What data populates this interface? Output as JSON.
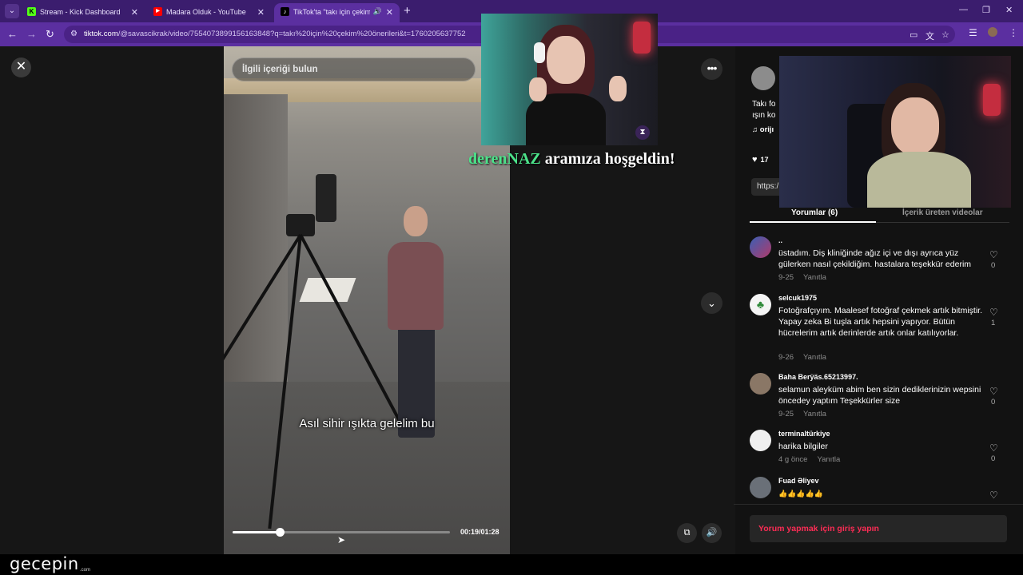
{
  "browser": {
    "tabs": [
      {
        "title": "Stream - Kick Dashboard",
        "favicon": "K"
      },
      {
        "title": "Madara Olduk - YouTube",
        "favicon": "▶"
      },
      {
        "title": "TikTok'ta \"takı için çekim ön",
        "favicon": "♪"
      }
    ],
    "url_host": "tiktok.com",
    "url_path": "/@savascikrak/video/7554073899156163848?q=takı%20için%20çekim%20önerileri&t=1760205637752"
  },
  "video": {
    "search_placeholder": "İlgili içeriği bulun",
    "caption": "Asıl sihir ışıkta gelelim bu",
    "timecode": "00:19/01:28",
    "progress": 0.216
  },
  "panel": {
    "description_line1": "Takı fo",
    "description_line2": "ışın ko",
    "music": "♫  orijı",
    "like_count": "17",
    "link_prefix": "https:/",
    "tabs": [
      "Yorumlar (6)",
      "İçerik üreten videolar"
    ],
    "comments": [
      {
        "user": "..",
        "text": "üstadım. Diş kliniğinde ağız içi ve dışı ayrıca yüz gülerken nasıl çekildiğim. hastalara teşekkür ederim",
        "date": "9-25",
        "reply": "Yanıtla",
        "likes": "0"
      },
      {
        "user": "selcuk1975",
        "text": "Fotoğrafçıyım. Maalesef fotoğraf çekmek artık bitmiştir. Yapay zeka Bi tuşla artık hepsini yapıyor. Bütün hücrelerim artık derinlerde artık onlar katılıyorlar.",
        "date": "9-26",
        "reply": "Yanıtla",
        "likes": "1"
      },
      {
        "user": "Baha Berÿäs.65213997.",
        "text": "selamun aleyküm abim ben sizin dediklerinizin wepsini öncedey yaptım Teşekkürler size",
        "date": "9-25",
        "reply": "Yanıtla",
        "likes": "0"
      },
      {
        "user": "terminaltürkiye",
        "text": "harika bilgiler",
        "date": "4 g önce",
        "reply": "Yanıtla",
        "likes": "0"
      },
      {
        "user": "Fuad Əliyev",
        "text": "👍👍👍👍👍",
        "date": "",
        "reply": "",
        "likes": ""
      }
    ],
    "login_prompt": "Yorum yapmak için giriş yapın"
  },
  "overlay": {
    "welcome_name": "derenNAZ",
    "welcome_text": " aramıza hoşgeldin!",
    "watermark": "gecepin",
    "watermark_sub": ".com"
  },
  "colors": {
    "accent": "#fe2c55",
    "browser": "#5b2fa0",
    "welcome_name": "#4ce38a"
  }
}
